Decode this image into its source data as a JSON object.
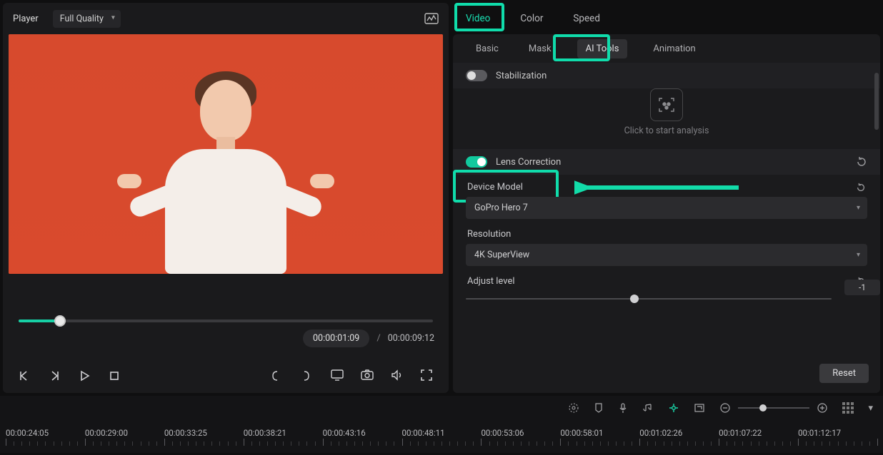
{
  "player": {
    "label": "Player",
    "quality": "Full Quality",
    "current_time": "00:00:01:09",
    "separator": "/",
    "total_time": "00:00:09:12"
  },
  "inspector": {
    "tabs_primary": {
      "video": "Video",
      "color": "Color",
      "speed": "Speed"
    },
    "tabs_secondary": {
      "basic": "Basic",
      "mask": "Mask",
      "aitools": "AI Tools",
      "animation": "Animation"
    },
    "stabilization": {
      "label": "Stabilization",
      "analysis_prompt": "Click to start analysis"
    },
    "lens_correction": {
      "label": "Lens Correction",
      "device_label": "Device Model",
      "device_value": "GoPro Hero 7",
      "resolution_label": "Resolution",
      "resolution_value": "4K SuperView",
      "adjust_label": "Adjust level",
      "adjust_value": "-1"
    },
    "reset_btn": "Reset"
  },
  "timeline": {
    "timecodes": [
      "00:00:24:05",
      "00:00:29:00",
      "00:00:33:25",
      "00:00:38:21",
      "00:00:43:16",
      "00:00:48:11",
      "00:00:53:06",
      "00:00:58:01",
      "00:01:02:26",
      "00:01:07:22",
      "00:01:12:17"
    ]
  }
}
